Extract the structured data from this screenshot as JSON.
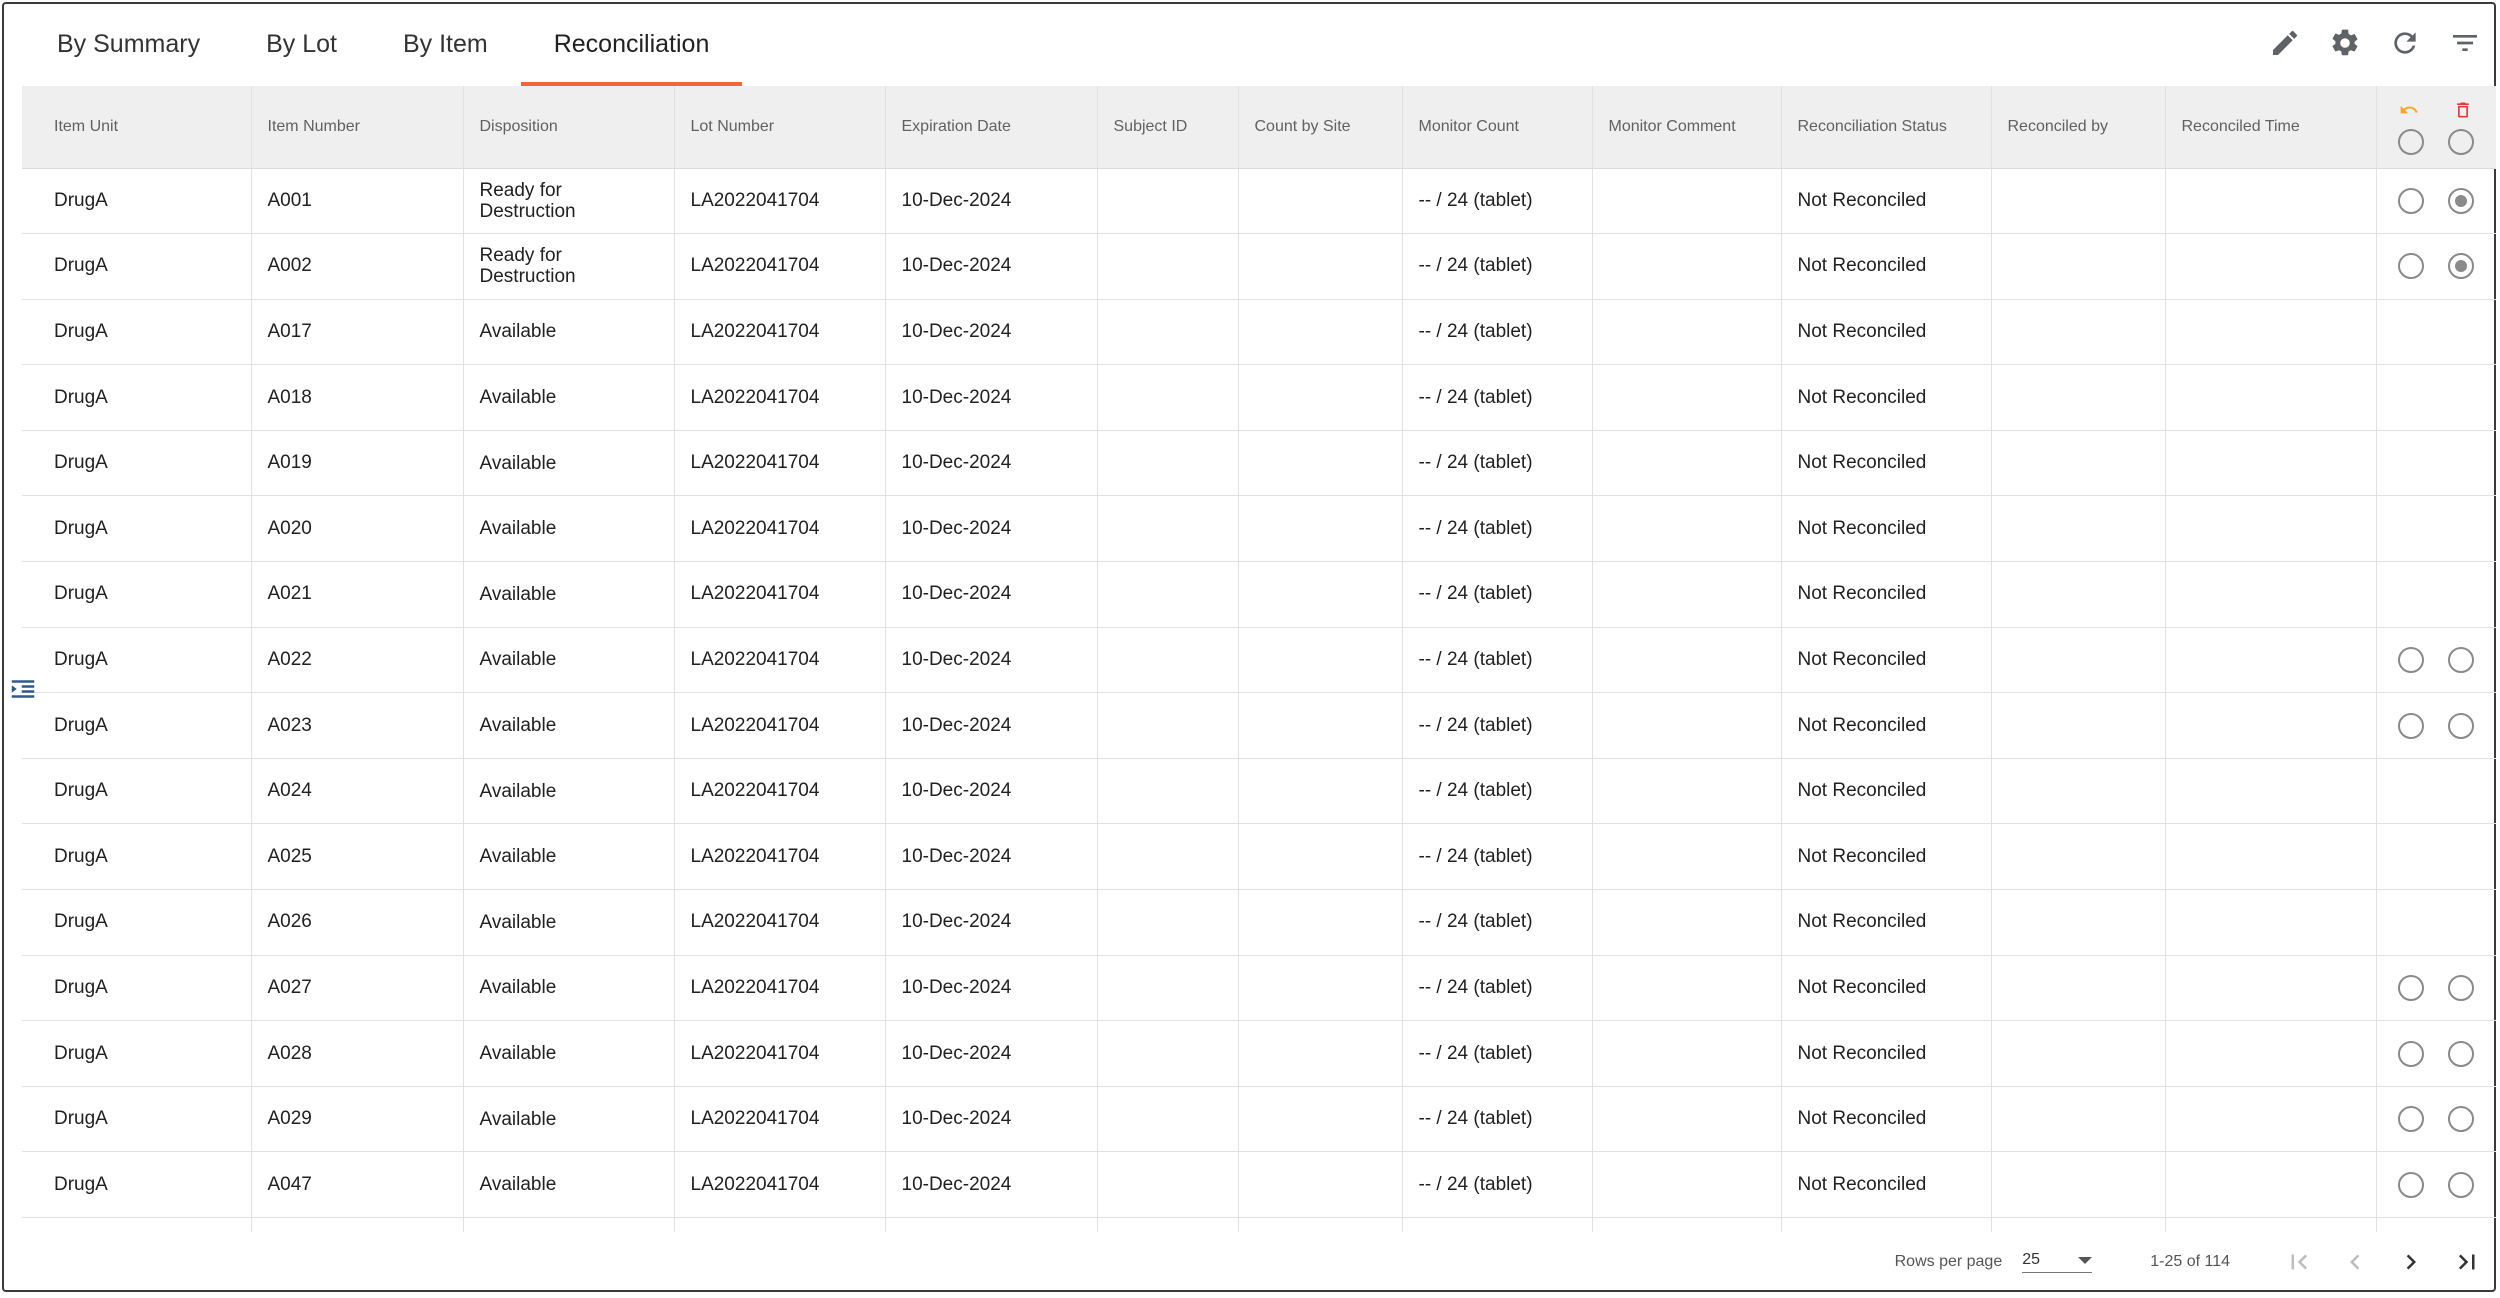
{
  "tabs": [
    "By Summary",
    "By Lot",
    "By Item",
    "Reconciliation"
  ],
  "active_tab": "Reconciliation",
  "toolbar": {
    "icons": [
      "edit-icon",
      "settings-icon",
      "refresh-icon",
      "filter-icon"
    ]
  },
  "columns": [
    "Item Unit",
    "Item Number",
    "Disposition",
    "Lot Number",
    "Expiration Date",
    "Subject ID",
    "Count by Site",
    "Monitor Count",
    "Monitor Comment",
    "Reconciliation Status",
    "Reconciled by",
    "Reconciled Time"
  ],
  "action_header": {
    "undo_color": "#f5a623",
    "delete_color": "#e53935"
  },
  "rows": [
    {
      "item_unit": "DrugA",
      "item_number": "A001",
      "disposition": "Ready for Destruction",
      "lot_number": "LA2022041704",
      "expiration_date": "10-Dec-2024",
      "subject_id": "",
      "count_by_site": "",
      "monitor_count": "-- / 24 (tablet)",
      "monitor_comment": "",
      "status": "Not Reconciled",
      "reconciled_by": "",
      "reconciled_time": "",
      "radios": "checked"
    },
    {
      "item_unit": "DrugA",
      "item_number": "A002",
      "disposition": "Ready for Destruction",
      "lot_number": "LA2022041704",
      "expiration_date": "10-Dec-2024",
      "subject_id": "",
      "count_by_site": "",
      "monitor_count": "-- / 24 (tablet)",
      "monitor_comment": "",
      "status": "Not Reconciled",
      "reconciled_by": "",
      "reconciled_time": "",
      "radios": "checked"
    },
    {
      "item_unit": "DrugA",
      "item_number": "A017",
      "disposition": "Available",
      "lot_number": "LA2022041704",
      "expiration_date": "10-Dec-2024",
      "subject_id": "",
      "count_by_site": "",
      "monitor_count": "-- / 24 (tablet)",
      "monitor_comment": "",
      "status": "Not Reconciled",
      "reconciled_by": "",
      "reconciled_time": "",
      "radios": "none"
    },
    {
      "item_unit": "DrugA",
      "item_number": "A018",
      "disposition": "Available",
      "lot_number": "LA2022041704",
      "expiration_date": "10-Dec-2024",
      "subject_id": "",
      "count_by_site": "",
      "monitor_count": "-- / 24 (tablet)",
      "monitor_comment": "",
      "status": "Not Reconciled",
      "reconciled_by": "",
      "reconciled_time": "",
      "radios": "none"
    },
    {
      "item_unit": "DrugA",
      "item_number": "A019",
      "disposition": "Available",
      "lot_number": "LA2022041704",
      "expiration_date": "10-Dec-2024",
      "subject_id": "",
      "count_by_site": "",
      "monitor_count": "-- / 24 (tablet)",
      "monitor_comment": "",
      "status": "Not Reconciled",
      "reconciled_by": "",
      "reconciled_time": "",
      "radios": "none"
    },
    {
      "item_unit": "DrugA",
      "item_number": "A020",
      "disposition": "Available",
      "lot_number": "LA2022041704",
      "expiration_date": "10-Dec-2024",
      "subject_id": "",
      "count_by_site": "",
      "monitor_count": "-- / 24 (tablet)",
      "monitor_comment": "",
      "status": "Not Reconciled",
      "reconciled_by": "",
      "reconciled_time": "",
      "radios": "none"
    },
    {
      "item_unit": "DrugA",
      "item_number": "A021",
      "disposition": "Available",
      "lot_number": "LA2022041704",
      "expiration_date": "10-Dec-2024",
      "subject_id": "",
      "count_by_site": "",
      "monitor_count": "-- / 24 (tablet)",
      "monitor_comment": "",
      "status": "Not Reconciled",
      "reconciled_by": "",
      "reconciled_time": "",
      "radios": "none"
    },
    {
      "item_unit": "DrugA",
      "item_number": "A022",
      "disposition": "Available",
      "lot_number": "LA2022041704",
      "expiration_date": "10-Dec-2024",
      "subject_id": "",
      "count_by_site": "",
      "monitor_count": "-- / 24 (tablet)",
      "monitor_comment": "",
      "status": "Not Reconciled",
      "reconciled_by": "",
      "reconciled_time": "",
      "radios": "empty"
    },
    {
      "item_unit": "DrugA",
      "item_number": "A023",
      "disposition": "Available",
      "lot_number": "LA2022041704",
      "expiration_date": "10-Dec-2024",
      "subject_id": "",
      "count_by_site": "",
      "monitor_count": "-- / 24 (tablet)",
      "monitor_comment": "",
      "status": "Not Reconciled",
      "reconciled_by": "",
      "reconciled_time": "",
      "radios": "empty"
    },
    {
      "item_unit": "DrugA",
      "item_number": "A024",
      "disposition": "Available",
      "lot_number": "LA2022041704",
      "expiration_date": "10-Dec-2024",
      "subject_id": "",
      "count_by_site": "",
      "monitor_count": "-- / 24 (tablet)",
      "monitor_comment": "",
      "status": "Not Reconciled",
      "reconciled_by": "",
      "reconciled_time": "",
      "radios": "none"
    },
    {
      "item_unit": "DrugA",
      "item_number": "A025",
      "disposition": "Available",
      "lot_number": "LA2022041704",
      "expiration_date": "10-Dec-2024",
      "subject_id": "",
      "count_by_site": "",
      "monitor_count": "-- / 24 (tablet)",
      "monitor_comment": "",
      "status": "Not Reconciled",
      "reconciled_by": "",
      "reconciled_time": "",
      "radios": "none"
    },
    {
      "item_unit": "DrugA",
      "item_number": "A026",
      "disposition": "Available",
      "lot_number": "LA2022041704",
      "expiration_date": "10-Dec-2024",
      "subject_id": "",
      "count_by_site": "",
      "monitor_count": "-- / 24 (tablet)",
      "monitor_comment": "",
      "status": "Not Reconciled",
      "reconciled_by": "",
      "reconciled_time": "",
      "radios": "none"
    },
    {
      "item_unit": "DrugA",
      "item_number": "A027",
      "disposition": "Available",
      "lot_number": "LA2022041704",
      "expiration_date": "10-Dec-2024",
      "subject_id": "",
      "count_by_site": "",
      "monitor_count": "-- / 24 (tablet)",
      "monitor_comment": "",
      "status": "Not Reconciled",
      "reconciled_by": "",
      "reconciled_time": "",
      "radios": "empty"
    },
    {
      "item_unit": "DrugA",
      "item_number": "A028",
      "disposition": "Available",
      "lot_number": "LA2022041704",
      "expiration_date": "10-Dec-2024",
      "subject_id": "",
      "count_by_site": "",
      "monitor_count": "-- / 24 (tablet)",
      "monitor_comment": "",
      "status": "Not Reconciled",
      "reconciled_by": "",
      "reconciled_time": "",
      "radios": "empty"
    },
    {
      "item_unit": "DrugA",
      "item_number": "A029",
      "disposition": "Available",
      "lot_number": "LA2022041704",
      "expiration_date": "10-Dec-2024",
      "subject_id": "",
      "count_by_site": "",
      "monitor_count": "-- / 24 (tablet)",
      "monitor_comment": "",
      "status": "Not Reconciled",
      "reconciled_by": "",
      "reconciled_time": "",
      "radios": "empty"
    },
    {
      "item_unit": "DrugA",
      "item_number": "A047",
      "disposition": "Available",
      "lot_number": "LA2022041704",
      "expiration_date": "10-Dec-2024",
      "subject_id": "",
      "count_by_site": "",
      "monitor_count": "-- / 24 (tablet)",
      "monitor_comment": "",
      "status": "Not Reconciled",
      "reconciled_by": "",
      "reconciled_time": "",
      "radios": "empty"
    },
    {
      "item_unit": "",
      "item_number": "",
      "disposition": "",
      "lot_number": "",
      "expiration_date": "",
      "subject_id": "",
      "count_by_site": "",
      "monitor_count": "",
      "monitor_comment": "",
      "status": "",
      "reconciled_by": "",
      "reconciled_time": "",
      "radios": "none"
    }
  ],
  "footer": {
    "rows_per_page_label": "Rows per page",
    "rows_per_page_value": "25",
    "range_text": "1-25 of 114"
  }
}
